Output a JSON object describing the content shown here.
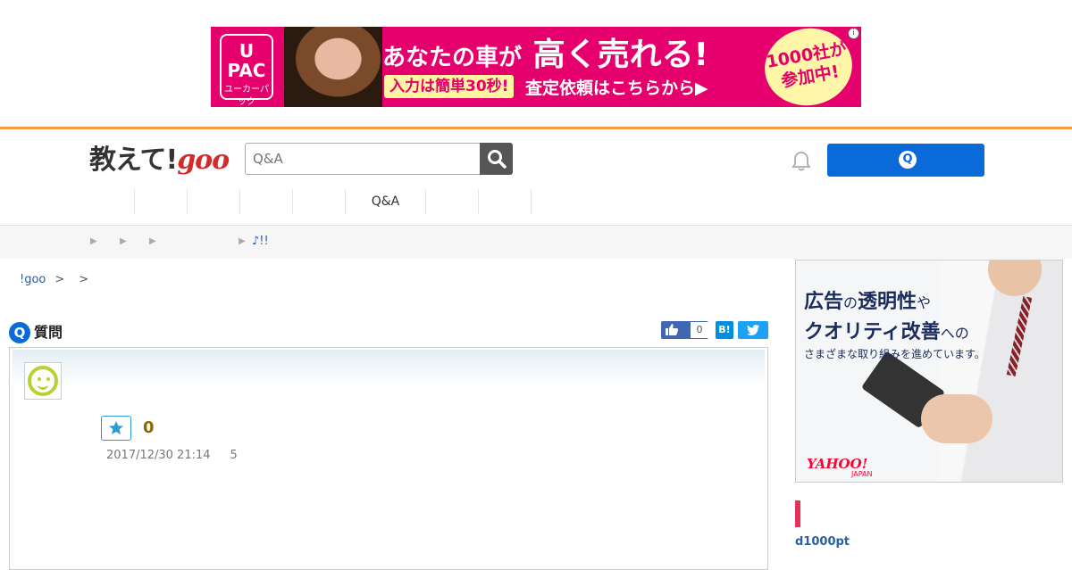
{
  "top_ad": {
    "logo_line1": "U",
    "logo_line2": "PAC",
    "logo_line3": "ユーカーパック",
    "headline_prefix": "あなたの車が",
    "headline_main": "高く売れる!",
    "badge": "入力は簡単30秒!",
    "subtext": "査定依頼はこちらから▶",
    "burst_line1": "1000社が",
    "burst_line2": "参加中!",
    "info": "i"
  },
  "header": {
    "logo_text": "教えて!",
    "logo_goo": "goo",
    "search_placeholder": "Q&A",
    "ask_button_icon_text": "Q",
    "nav_items": [
      "",
      "",
      "",
      "",
      "",
      "Q&A",
      "",
      ""
    ]
  },
  "subbar": {
    "chevron": "▶",
    "link": "♪!!"
  },
  "breadcrumb": {
    "home": "!goo",
    "sep": ">"
  },
  "question": {
    "icon_text": "Q",
    "title": "質問",
    "like_count": "0",
    "hatena_label": "B!",
    "star_count": "0",
    "date": "2017/12/30 21:14",
    "view_count": "5"
  },
  "side_ad": {
    "line1_a": "広告",
    "line1_b": "の",
    "line1_c": "透明性",
    "line1_d": "や",
    "line2_a": "クオリティ改善",
    "line2_b": "への",
    "line3": "さまざまな取り組みを進めています。",
    "brand": "YAHOO!",
    "brand_sub": "JAPAN"
  },
  "sidebar": {
    "points": "d1000pt"
  },
  "colors": {
    "header_accent": "#f39b49",
    "primary_blue": "#0a6ad8",
    "ad_pink": "#e6006e",
    "sidebar_mark": "#e6325a"
  }
}
